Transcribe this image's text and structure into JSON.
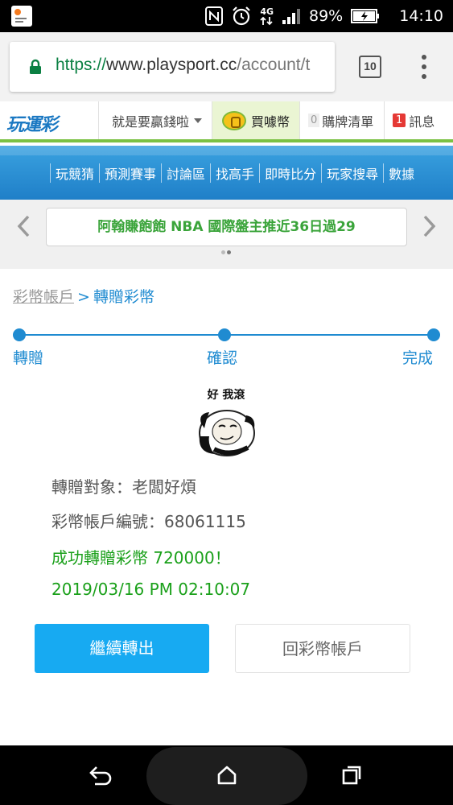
{
  "status_bar": {
    "battery": "89%",
    "time": "14:10",
    "network": "4G",
    "icons": [
      "notification-app-icon",
      "nfc-icon",
      "alarm-icon",
      "signal-icon",
      "battery-charging-icon"
    ]
  },
  "browser": {
    "url_scheme": "https://",
    "url_host": "www.playsport.cc",
    "url_path": "/account/t",
    "tab_count": "10"
  },
  "site_header": {
    "logo": "玩運彩",
    "dropdown_label": "就是要贏錢啦",
    "buy_coin_label": "買噱幣",
    "cart_count": "0",
    "cart_label": "購牌清單",
    "message_count": "1",
    "message_label": "訊息",
    "accent_color": "#7bc143"
  },
  "main_nav": {
    "items": [
      "玩競猜",
      "預測賽事",
      "討論區",
      "找高手",
      "即時比分",
      "玩家搜尋",
      "數據"
    ]
  },
  "banner": {
    "text": "阿翰賺飽飽 NBA 國際盤主推近36日過29"
  },
  "breadcrumb": {
    "parent": "彩幣帳戶",
    "separator": ">",
    "current": "轉贈彩幣"
  },
  "steps": [
    "轉贈",
    "確認",
    "完成"
  ],
  "sticker": {
    "caption": "好 我滾"
  },
  "result": {
    "recipient": "轉贈對象：老闆好煩",
    "account": "彩幣帳戶編號：68061115",
    "success": "成功轉贈彩幣 720000！",
    "timestamp": "2019/03/16 PM 02:10:07"
  },
  "actions": {
    "continue_label": "繼續轉出",
    "back_label": "回彩幣帳戶",
    "primary_color": "#17aaf2"
  }
}
